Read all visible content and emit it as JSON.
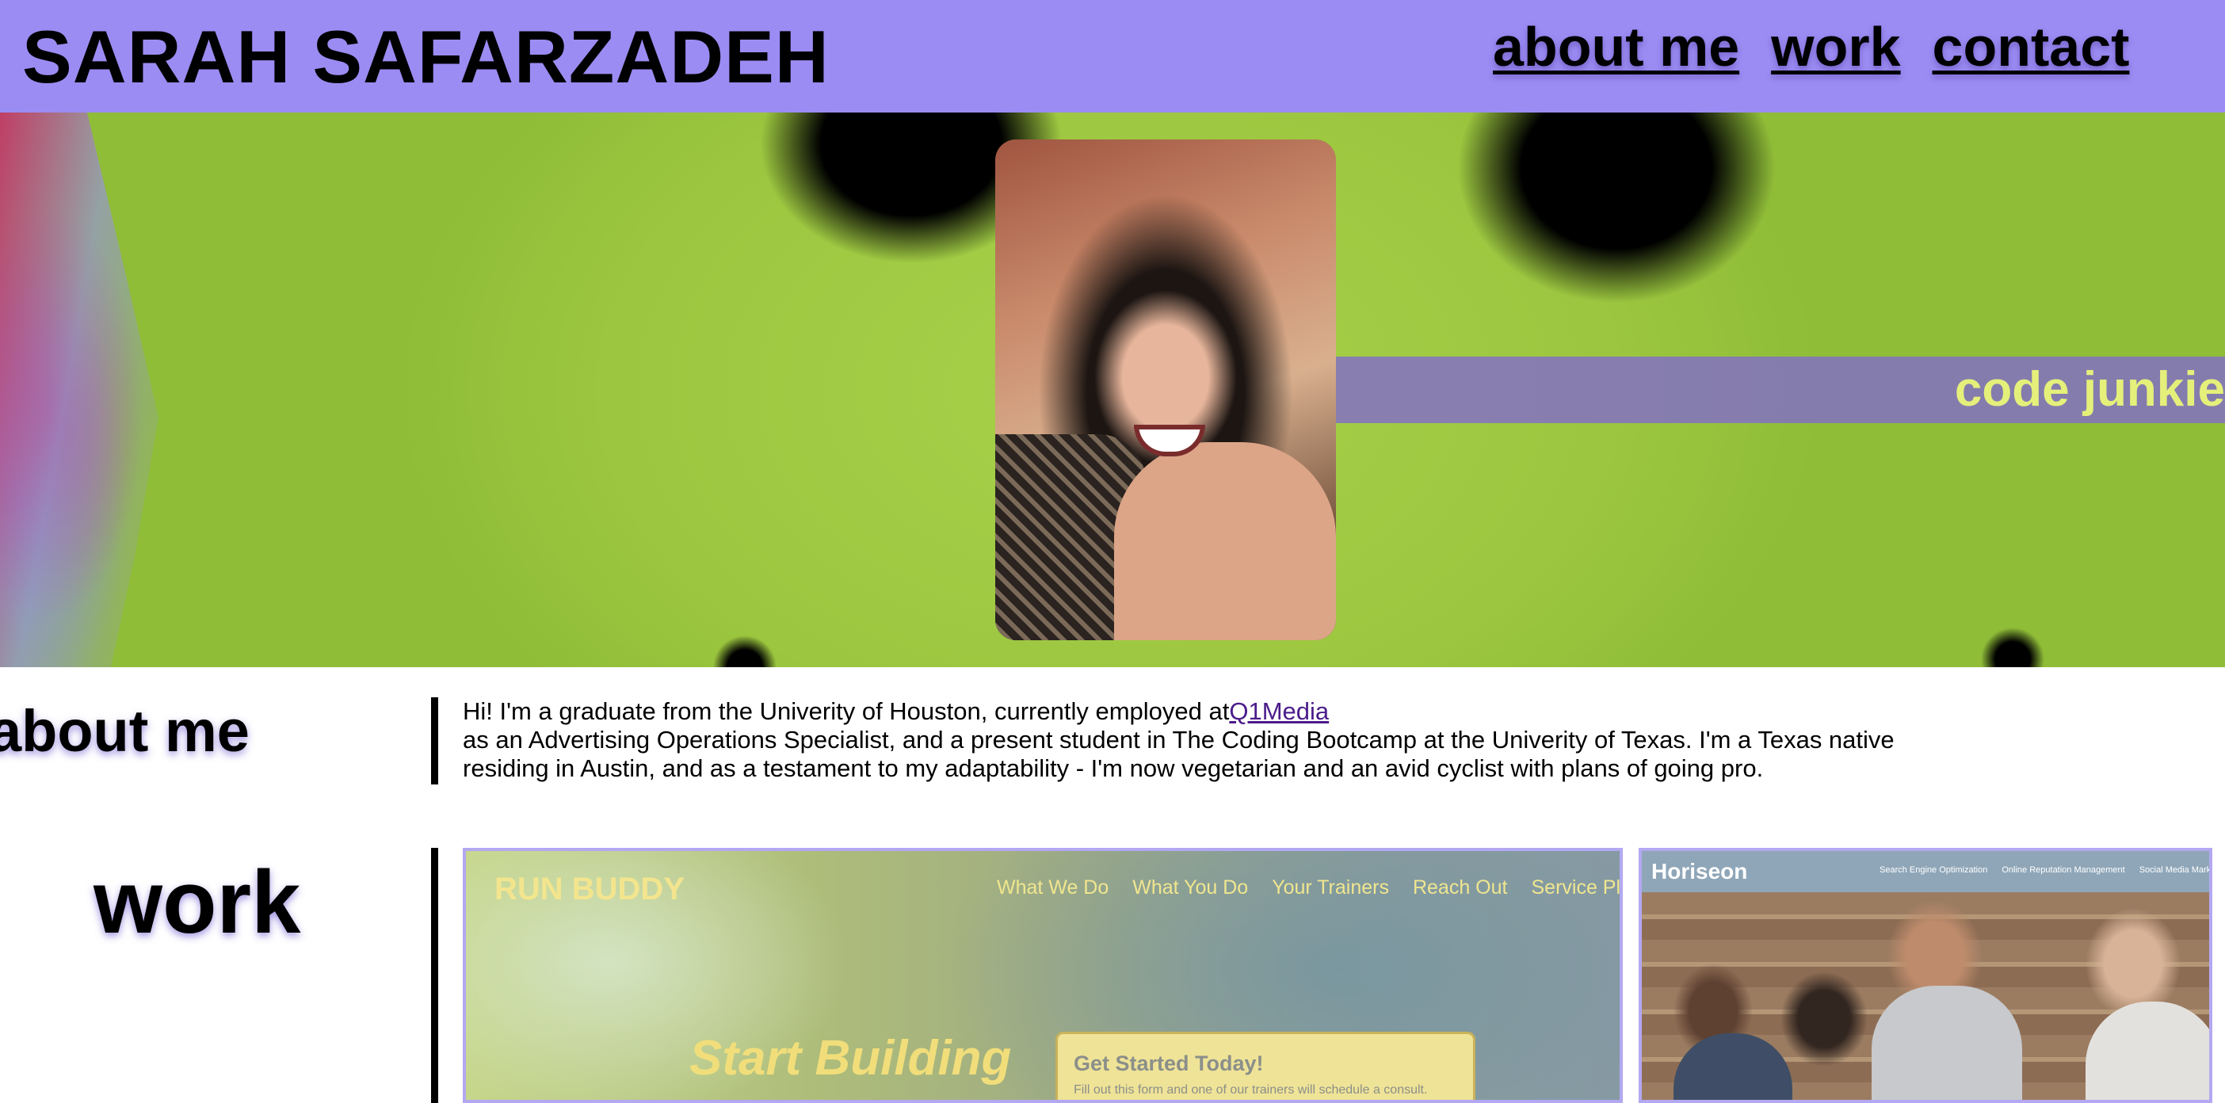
{
  "header": {
    "title": "SARAH SAFARZADEH",
    "nav": [
      "about me",
      "work",
      "contact"
    ]
  },
  "hero": {
    "tagline": "code junkie",
    "portrait_alt": "portrait photo"
  },
  "about": {
    "heading": "about me",
    "text_before_link": "Hi! I'm a graduate from the Univerity of Houston, currently employed at",
    "link_text": "Q1Media",
    "text_after_link": "as an Advertising Operations Specialist, and a present student in The Coding Bootcamp at the Univerity of Texas. I'm a Texas native residing in Austin, and as a testament to my adaptability - I'm now vegetarian and an avid cyclist with plans of going pro."
  },
  "work": {
    "heading": "work",
    "projects": [
      {
        "name": "RUN BUDDY",
        "nav": [
          "What We Do",
          "What You Do",
          "Your Trainers",
          "Reach Out",
          "Service Plans"
        ],
        "hero_text": "Start Building",
        "form_title": "Get Started Today!",
        "form_subtitle": "Fill out this form and one of our trainers will schedule a consult."
      },
      {
        "name": "Horiseon",
        "nav": [
          "Search Engine Optimization",
          "Online Reputation Management",
          "Social Media Marketing"
        ]
      }
    ]
  },
  "colors": {
    "header_bg": "#9b8cf3",
    "tagline_band": "#826ec8",
    "tagline_text": "#e4f07a",
    "link": "#4b1c8a",
    "card_border": "#b3a8f1"
  }
}
